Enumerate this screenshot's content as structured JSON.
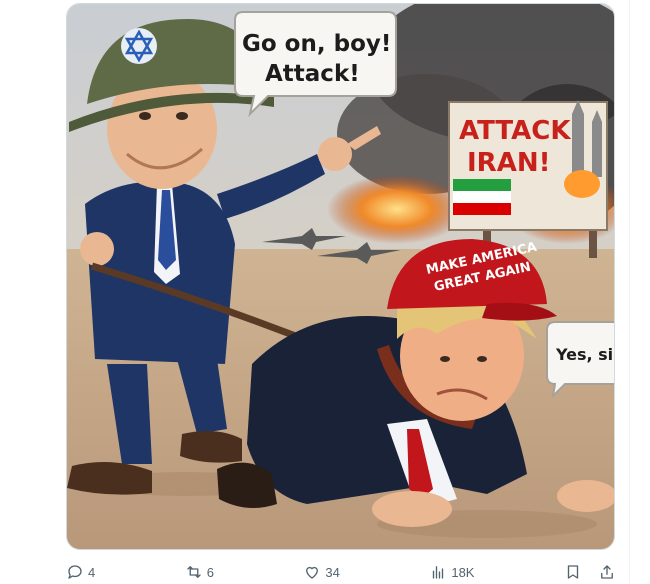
{
  "media": {
    "speech_top": [
      "Go on, boy!",
      "Attack!"
    ],
    "speech_right": "Yes, sir",
    "sign": [
      "ATTACK",
      "IRAN!"
    ],
    "cap": [
      "MAKE AMERICA",
      "GREAT AGAIN"
    ]
  },
  "actions": {
    "reply": {
      "count": "4",
      "icon": "reply-icon"
    },
    "repost": {
      "count": "6",
      "icon": "repost-icon"
    },
    "like": {
      "count": "34",
      "icon": "heart-icon"
    },
    "views": {
      "count": "18K",
      "icon": "views-icon"
    },
    "bookmark": {
      "icon": "bookmark-icon"
    },
    "share": {
      "icon": "share-icon"
    }
  },
  "colors": {
    "accent_icon": "#536471",
    "border": "#cfd9de",
    "sign_red": "#c8201a",
    "cap_red": "#c0161c"
  }
}
